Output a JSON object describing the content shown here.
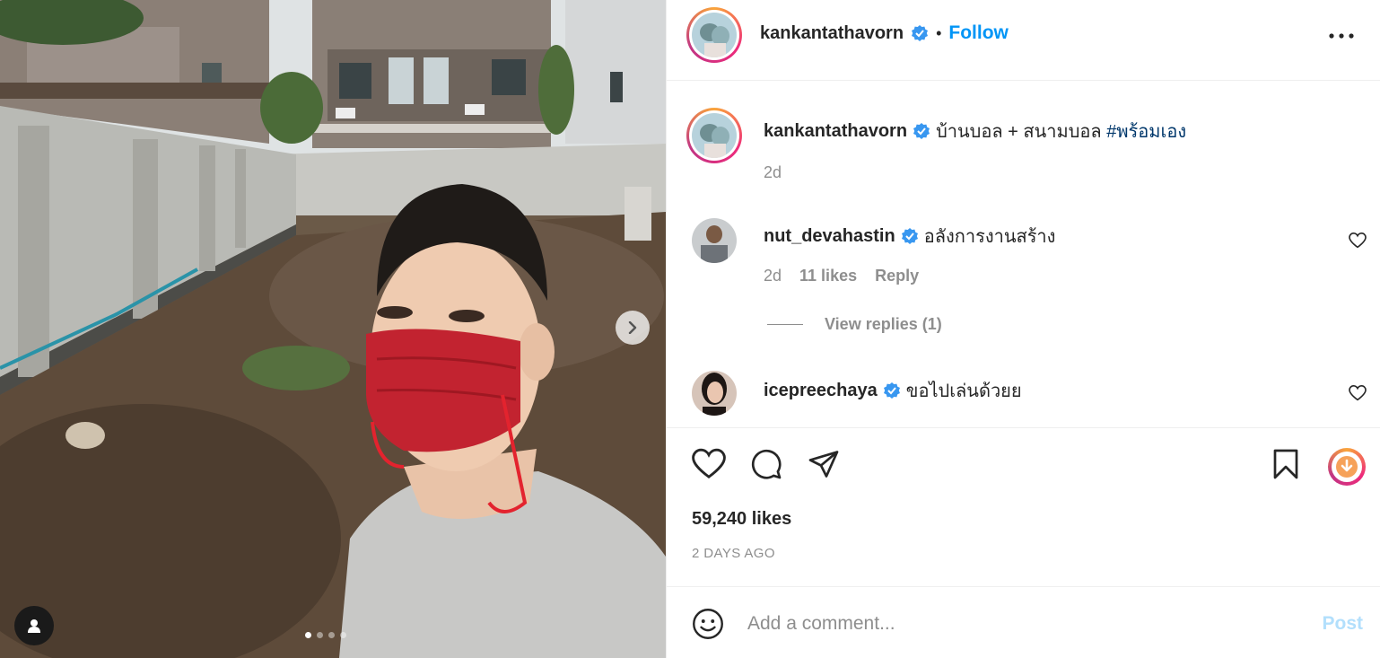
{
  "post": {
    "author": "kankantathavorn",
    "follow_label": "Follow",
    "separator": "•",
    "more_icon": "more-horizontal-icon",
    "caption": {
      "username": "kankantathavorn",
      "text": "บ้านบอล + สนามบอล ",
      "hashtag": "#พร้อมเอง",
      "age": "2d"
    },
    "comments": [
      {
        "username": "nut_devahastin",
        "text": "อลังการงานสร้าง",
        "age": "2d",
        "likes": "11 likes",
        "reply_label": "Reply",
        "view_replies": "View replies (1)"
      },
      {
        "username": "icepreechaya",
        "text": "ขอไปเล่นด้วยย"
      }
    ],
    "likes": "59,240 likes",
    "timestamp": "2 DAYS AGO",
    "composer": {
      "placeholder": "Add a comment...",
      "post_label": "Post"
    },
    "carousel": {
      "current": 1,
      "total": 4
    }
  },
  "colors": {
    "accent": "#0095f6",
    "muted": "#8e8e8e",
    "hashtag": "#00376b",
    "post_disabled": "#b2dffc",
    "verified": "#3897f0"
  }
}
